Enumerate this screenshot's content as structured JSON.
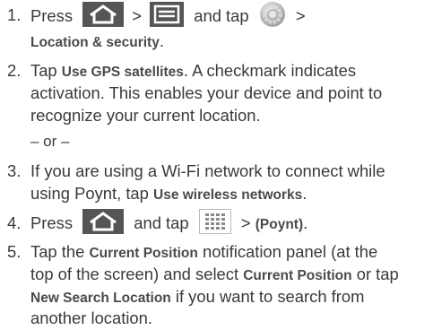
{
  "steps": [
    {
      "number": "1.",
      "line1_pre": "Press",
      "sep1": ">",
      "line1_mid": "and tap",
      "sep2": ">",
      "line2_bold": "Location & security",
      "line2_tail": "."
    },
    {
      "number": "2.",
      "line1_pre": "Tap ",
      "line1_bold": "Use GPS satellites",
      "line1_tail": ". A checkmark indicates",
      "line2": "activation. This enables your device and point to",
      "line3": "recognize your current location."
    },
    {
      "number": "3.",
      "line1": "If you are using a Wi-Fi network to connect while",
      "line2_pre": "using Poynt, tap ",
      "line2_bold": "Use wireless networks",
      "line2_tail": "."
    },
    {
      "number": "4.",
      "line1_pre": "Press",
      "line1_mid": "and tap",
      "sep": ">",
      "line1_bold": "(Poynt)",
      "line1_tail": "."
    },
    {
      "number": "5.",
      "line1_pre": "Tap the ",
      "line1_bold": "Current Position",
      "line1_tail": " notification panel (at the",
      "line2_pre": "top of the screen) and select ",
      "line2_bold": "Current Position",
      "line2_tail": " or tap",
      "line3_bold": "New Search Location",
      "line3_tail": " if you want to search from",
      "line4": "another location."
    }
  ],
  "or_text": "– or –",
  "icons": {
    "home": "home-key-icon",
    "menu": "menu-key-icon",
    "settings": "settings-icon",
    "apps": "applications-icon"
  }
}
